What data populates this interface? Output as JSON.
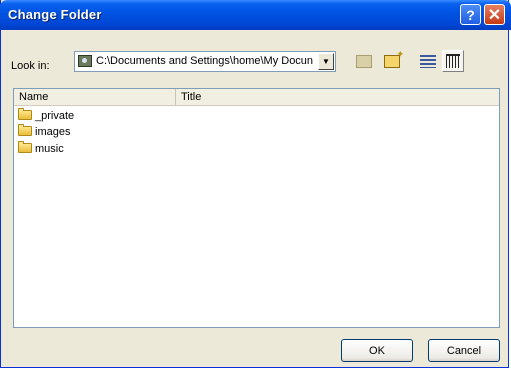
{
  "window": {
    "title": "Change Folder",
    "help_symbol": "?",
    "close_symbol": "✕"
  },
  "lookin": {
    "label": "Look in:",
    "path": "C:\\Documents and Settings\\home\\My Docun",
    "arrow": "▼",
    "icon": "drive-icon"
  },
  "toolbar": {
    "icons": [
      "up-folder-icon",
      "new-folder-icon",
      "list-view-icon",
      "details-view-icon"
    ]
  },
  "list": {
    "columns": [
      "Name",
      "Title"
    ],
    "items": [
      {
        "name": "_private",
        "title": "",
        "icon": "folder-icon"
      },
      {
        "name": "images",
        "title": "",
        "icon": "folder-icon"
      },
      {
        "name": "music",
        "title": "",
        "icon": "folder-icon"
      }
    ]
  },
  "buttons": {
    "ok": "OK",
    "cancel": "Cancel"
  },
  "colors": {
    "titlebar": "#0054e3",
    "dialog_bg": "#ece9d8",
    "close_button": "#c63a14"
  }
}
